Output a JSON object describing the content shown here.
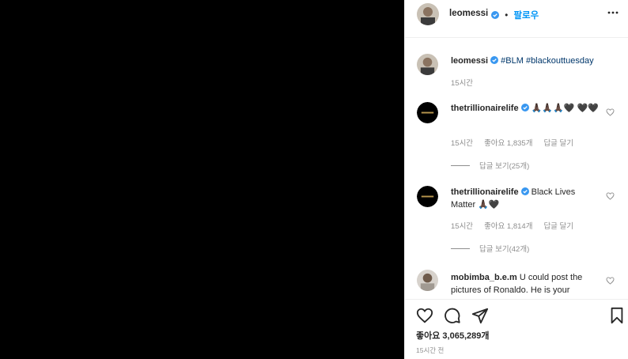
{
  "header": {
    "username": "leomessi",
    "separator": "•",
    "follow_label": "팔로우"
  },
  "comments": [
    {
      "username": "leomessi",
      "text": "#BLM #blackouttuesday",
      "time": "15시간"
    },
    {
      "username": "thetrillionairelife",
      "text": "🙏🏿🙏🏿🙏🏿🖤 🖤🖤",
      "time": "15시간",
      "likes": "좋아요 1,835개",
      "reply_label": "답글 달기",
      "view_replies": "답글 보기(25개)"
    },
    {
      "username": "thetrillionairelife",
      "text": "Black Lives Matter 🙏🏿🖤",
      "time": "15시간",
      "likes": "좋아요 1,814개",
      "reply_label": "답글 달기",
      "view_replies": "답글 보기(42개)"
    },
    {
      "username": "mobimba_b.e.m",
      "text": "U could post the pictures of Ronaldo. He is your"
    }
  ],
  "post": {
    "likes": "좋아요 3,065,289개",
    "time": "15시간 전"
  },
  "colors": {
    "accent": "#0095f6",
    "hashtag": "#00376b",
    "muted": "#8e8e8e",
    "media_bg": "#000000"
  },
  "icons": [
    "verified-badge-icon",
    "more-options-icon",
    "heart-icon",
    "comment-icon",
    "share-icon",
    "bookmark-icon"
  ]
}
